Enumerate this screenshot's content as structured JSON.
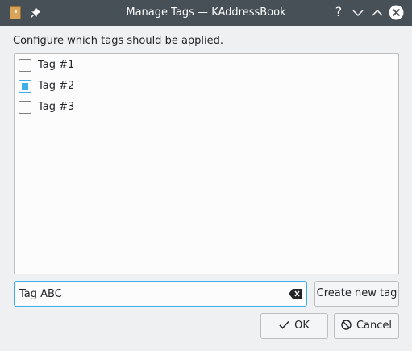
{
  "window": {
    "title": "Manage Tags — KAddressBook",
    "help_glyph": "?",
    "icons": {
      "app": "kaddressbook-app-icon",
      "pin": "pin-icon",
      "minimize": "chevron-down-icon",
      "maximize": "chevron-up-icon",
      "close": "close-icon"
    }
  },
  "dialog": {
    "instruction": "Configure which tags should be applied.",
    "tags": [
      {
        "label": "Tag #1",
        "checked": false
      },
      {
        "label": "Tag #2",
        "checked": true
      },
      {
        "label": "Tag #3",
        "checked": false
      }
    ],
    "new_tag_input": {
      "value": "Tag ABC",
      "placeholder": ""
    },
    "create_button_label": "Create new tag",
    "ok_button_label": "OK",
    "cancel_button_label": "Cancel"
  },
  "colors": {
    "titlebar": "#475057",
    "accent": "#3daee9",
    "background": "#eff0f1"
  }
}
